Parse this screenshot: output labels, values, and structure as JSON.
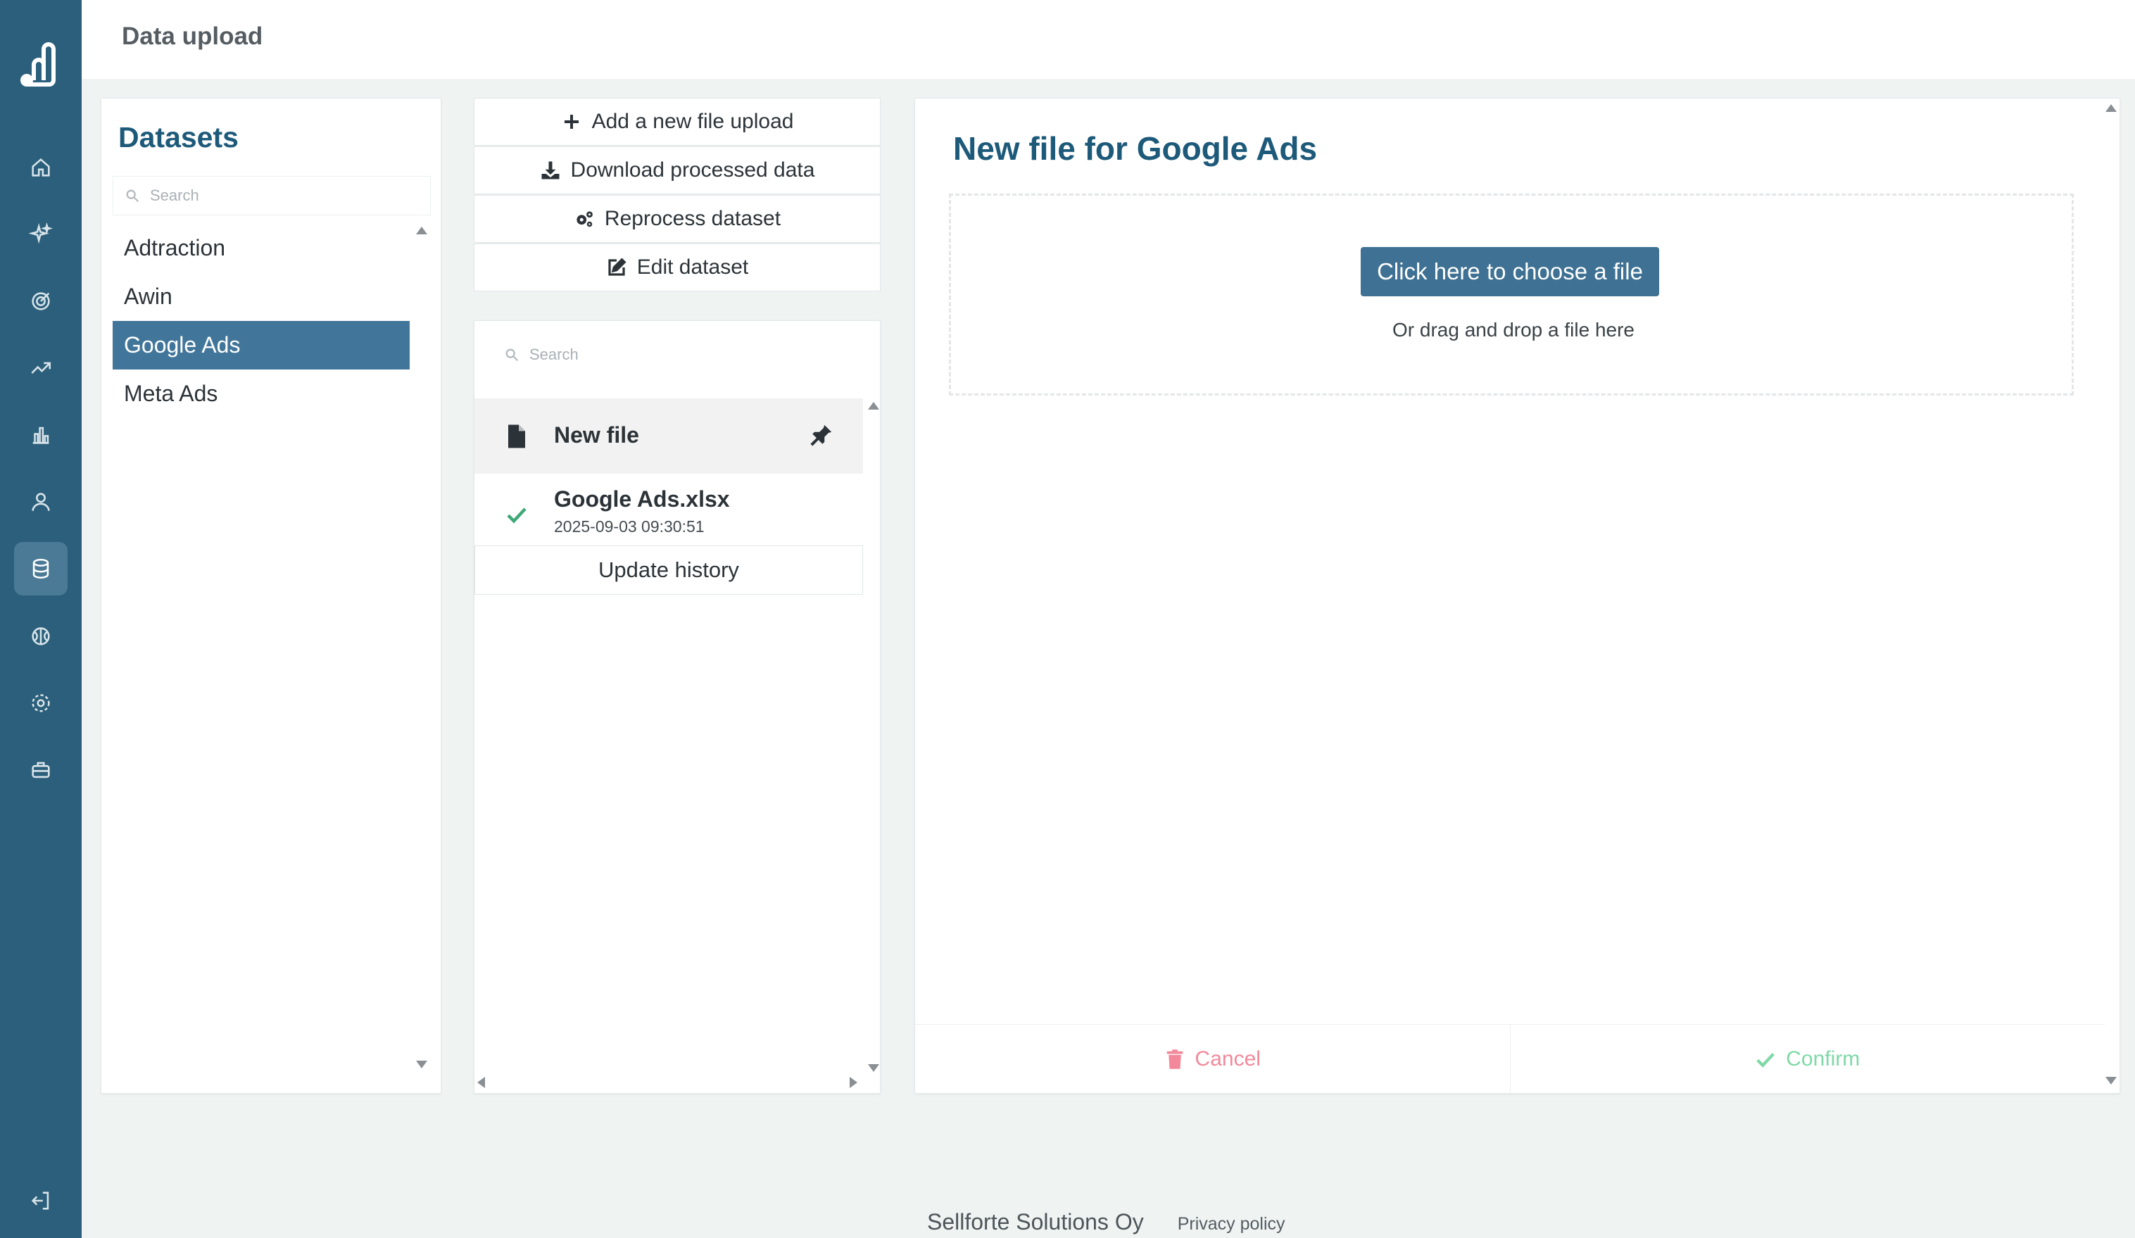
{
  "header": {
    "title": "Data upload"
  },
  "nav": {
    "items": [
      {
        "icon": "home-icon"
      },
      {
        "icon": "sparkles-icon"
      },
      {
        "icon": "target-icon"
      },
      {
        "icon": "trend-icon"
      },
      {
        "icon": "bar-chart-icon"
      },
      {
        "icon": "user-icon"
      },
      {
        "icon": "database-icon",
        "active": true
      },
      {
        "icon": "brain-icon"
      },
      {
        "icon": "gear-icon"
      },
      {
        "icon": "briefcase-icon"
      }
    ],
    "logout_icon": "logout-icon"
  },
  "datasets": {
    "heading": "Datasets",
    "search_placeholder": "Search",
    "items": [
      "Adtraction",
      "Awin",
      "Google Ads",
      "Meta Ads"
    ],
    "selected": "Google Ads"
  },
  "actions": {
    "add_upload": "Add a new file upload",
    "download": "Download processed data",
    "reprocess": "Reprocess dataset",
    "edit": "Edit dataset"
  },
  "files": {
    "search_placeholder": "Search",
    "new_file": "New file",
    "history_item": {
      "name": "Google Ads.xlsx",
      "date": "2025-09-03 09:30:51"
    },
    "update_history": "Update history"
  },
  "main": {
    "heading": "New file for Google Ads",
    "choose_button": "Click here to choose a file",
    "drop_hint": "Or drag and drop a file here",
    "cancel": "Cancel",
    "confirm": "Confirm"
  },
  "footer": {
    "company": "Sellforte Solutions Oy",
    "privacy": "Privacy policy"
  },
  "colors": {
    "rail": "#2b5f7b",
    "accent": "#41769a",
    "heading": "#1d5a7a",
    "cancel": "#f2889a",
    "confirm": "#7fd9a6",
    "check": "#3fa877"
  }
}
